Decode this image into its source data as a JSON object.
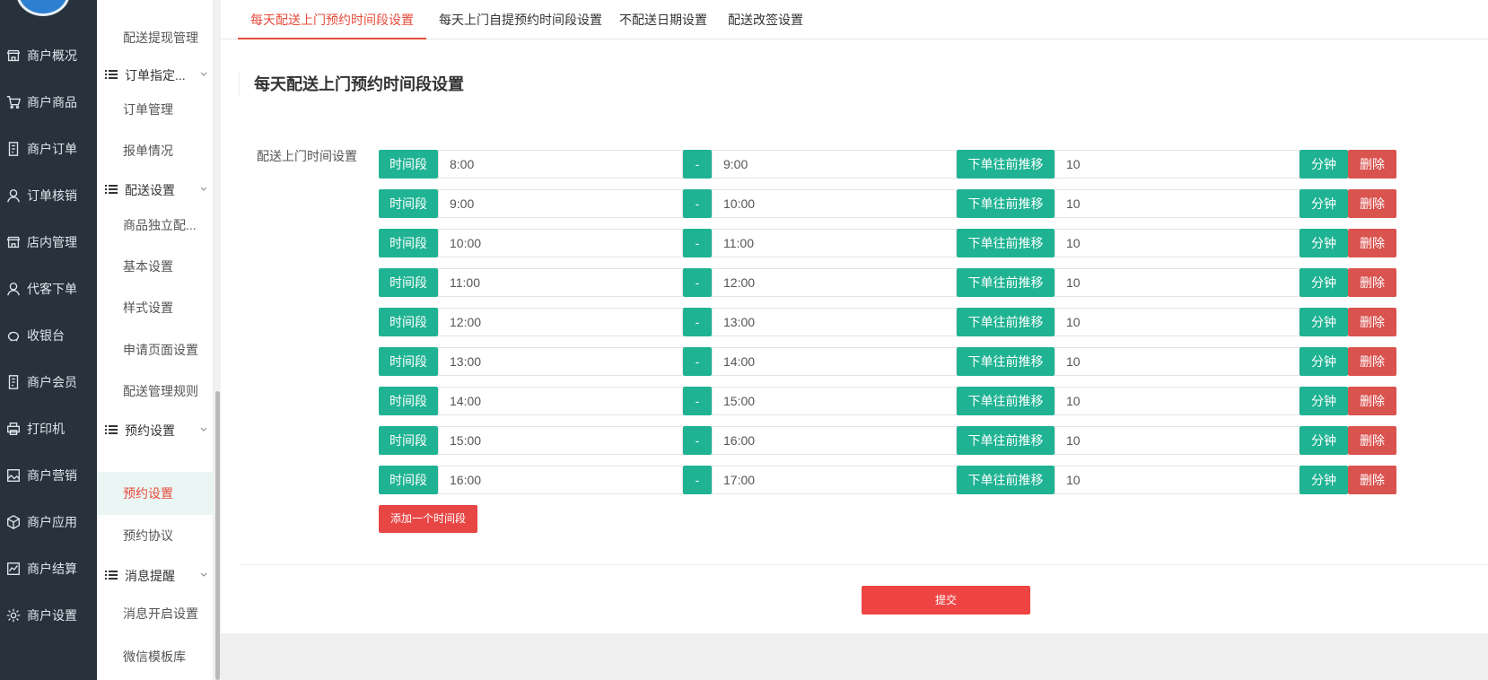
{
  "nav1": {
    "items": [
      {
        "label": "商户概况",
        "icon": "store-icon"
      },
      {
        "label": "商户商品",
        "icon": "cart-icon"
      },
      {
        "label": "商户订单",
        "icon": "order-doc-icon"
      },
      {
        "label": "订单核销",
        "icon": "user-icon"
      },
      {
        "label": "店内管理",
        "icon": "shop-icon"
      },
      {
        "label": "代客下单",
        "icon": "user-icon"
      },
      {
        "label": "收银台",
        "icon": "piggy-bank-icon"
      },
      {
        "label": "商户会员",
        "icon": "member-doc-icon"
      },
      {
        "label": "打印机",
        "icon": "printer-icon"
      },
      {
        "label": "商户营销",
        "icon": "image-icon"
      },
      {
        "label": "商户应用",
        "icon": "cube-icon"
      },
      {
        "label": "商户结算",
        "icon": "chart-icon"
      },
      {
        "label": "商户设置",
        "icon": "gear-icon"
      }
    ]
  },
  "nav2": {
    "top_item": "配送提现管理",
    "groups": [
      {
        "label": "订单指定...",
        "items": [
          "订单管理",
          "报单情况"
        ]
      },
      {
        "label": "配送设置",
        "items": [
          "商品独立配...",
          "基本设置",
          "样式设置",
          "申请页面设置",
          "配送管理规则"
        ]
      },
      {
        "label": "预约设置",
        "items": [
          "预约设置",
          "预约协议"
        ],
        "active": "预约设置"
      },
      {
        "label": "消息提醒",
        "items": [
          "消息开启设置",
          "微信模板库"
        ]
      }
    ]
  },
  "tabs": [
    {
      "label": "每天配送上门预约时间段设置",
      "active": true
    },
    {
      "label": "每天上门自提预约时间段设置",
      "active": false
    },
    {
      "label": "不配送日期设置",
      "active": false
    },
    {
      "label": "配送改签设置",
      "active": false
    }
  ],
  "section_title": "每天配送上门预约时间段设置",
  "form_label": "配送上门时间设置",
  "row_labels": {
    "period": "时间段",
    "dash": "-",
    "advance": "下单往前推移",
    "minutes": "分钟",
    "delete": "删除"
  },
  "time_rows": [
    {
      "start": "8:00",
      "end": "9:00",
      "advance": "10"
    },
    {
      "start": "9:00",
      "end": "10:00",
      "advance": "10"
    },
    {
      "start": "10:00",
      "end": "11:00",
      "advance": "10"
    },
    {
      "start": "11:00",
      "end": "12:00",
      "advance": "10"
    },
    {
      "start": "12:00",
      "end": "13:00",
      "advance": "10"
    },
    {
      "start": "13:00",
      "end": "14:00",
      "advance": "10"
    },
    {
      "start": "14:00",
      "end": "15:00",
      "advance": "10"
    },
    {
      "start": "15:00",
      "end": "16:00",
      "advance": "10"
    },
    {
      "start": "16:00",
      "end": "17:00",
      "advance": "10"
    }
  ],
  "add_button": "添加一个时间段",
  "submit_button": "提交",
  "colors": {
    "sidebar_bg": "#27323d",
    "accent_red": "#e74c3c",
    "addon_green": "#1fb393",
    "delete_red": "#d9534f",
    "active_bg": "#eaf6f4"
  }
}
